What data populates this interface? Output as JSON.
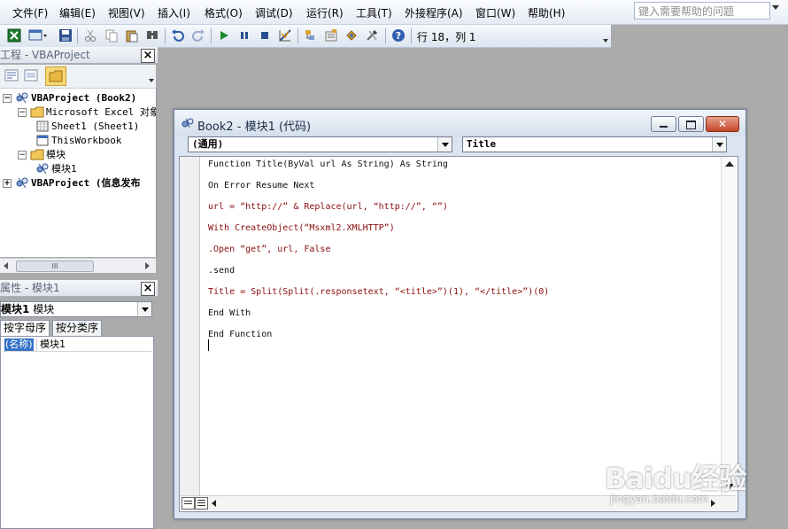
{
  "menu": {
    "items": [
      "文件(F)",
      "编辑(E)",
      "视图(V)",
      "插入(I)",
      "格式(O)",
      "调试(D)",
      "运行(R)",
      "工具(T)",
      "外接程序(A)",
      "窗口(W)",
      "帮助(H)"
    ],
    "help_placeholder": "键入需要帮助的问题"
  },
  "toolbar": {
    "icons": [
      "excel-icon",
      "insert-userform-icon",
      "save-icon",
      "cut-icon",
      "copy-icon",
      "paste-icon",
      "find-icon",
      "undo-icon",
      "redo-icon",
      "run-icon",
      "break-icon",
      "reset-icon",
      "design-mode-icon",
      "project-explorer-icon",
      "properties-icon",
      "object-browser-icon",
      "toolbox-icon",
      "help-icon"
    ],
    "cursor_position": "行 18，列 1"
  },
  "project_panel": {
    "title": "工程 - VBAProject",
    "tree": [
      {
        "label": "VBAProject (Book2)",
        "level": 0,
        "bold": true,
        "expander": "−",
        "icon": "vba-project-icon"
      },
      {
        "label": "Microsoft Excel 对象",
        "level": 1,
        "bold": false,
        "expander": "−",
        "icon": "folder-icon"
      },
      {
        "label": "Sheet1 (Sheet1)",
        "level": 2,
        "bold": false,
        "expander": "",
        "icon": "sheet-icon"
      },
      {
        "label": "ThisWorkbook",
        "level": 2,
        "bold": false,
        "expander": "",
        "icon": "workbook-icon"
      },
      {
        "label": "模块",
        "level": 1,
        "bold": false,
        "expander": "−",
        "icon": "folder-icon"
      },
      {
        "label": "模块1",
        "level": 2,
        "bold": false,
        "expander": "",
        "icon": "module-icon"
      },
      {
        "label": "VBAProject (信息发布",
        "level": 0,
        "bold": true,
        "expander": "+",
        "icon": "vba-project-icon"
      }
    ],
    "scroll_thumb": "III"
  },
  "properties_panel": {
    "title": "属性 - 模块1",
    "object_name": "模块1",
    "object_type": "模块",
    "tabs": [
      "按字母序",
      "按分类序"
    ],
    "rows": [
      {
        "name": "(名称)",
        "value": "模块1"
      }
    ]
  },
  "code_window": {
    "title": "Book2 - 模块1 (代码)",
    "object_combo": "(通用)",
    "proc_combo": "Title",
    "lines": [
      {
        "text": "Function Title(ByVal url As String) As String",
        "color": "black"
      },
      {
        "text": "On Error Resume Next",
        "color": "black"
      },
      {
        "text": "url = “http://” & Replace(url, “http://”, “”)",
        "color": "red"
      },
      {
        "text": "With CreateObject(“Msxml2.XMLHTTP”)",
        "color": "red"
      },
      {
        "text": ".Open “get”, url, False",
        "color": "red"
      },
      {
        "text": ".send",
        "color": "black"
      },
      {
        "text": "Title = Split(Split(.responsetext, “<title>”)(1), “</title>”)(0)",
        "color": "red"
      },
      {
        "text": "End With",
        "color": "black"
      },
      {
        "text": "End Function",
        "color": "black"
      }
    ]
  },
  "watermark": {
    "brand": "Baidu经验",
    "url": "jingyan.baidu.com"
  }
}
